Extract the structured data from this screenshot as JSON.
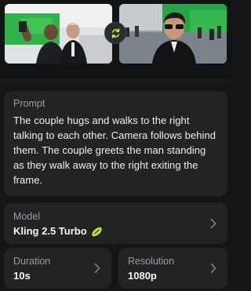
{
  "images": {
    "start_frame_icon": "photo-thumbnail-icon",
    "end_frame_icon": "photo-thumbnail-icon",
    "swap_icon": "swap-arrows-icon"
  },
  "prompt": {
    "label": "Prompt",
    "text": "The couple hugs and walks to the right talking to each other. Camera follows behind them. The couple greets the man standing as they walk away to the right exiting the frame."
  },
  "model": {
    "label": "Model",
    "value": "Kling 2.5 Turbo",
    "icon": "kling-logo-icon"
  },
  "duration": {
    "label": "Duration",
    "value": "10s"
  },
  "resolution": {
    "label": "Resolution",
    "value": "1080p"
  },
  "colors": {
    "background": "#141516",
    "card": "#222325",
    "accent": "#c8f028",
    "label": "#9b9da0"
  }
}
